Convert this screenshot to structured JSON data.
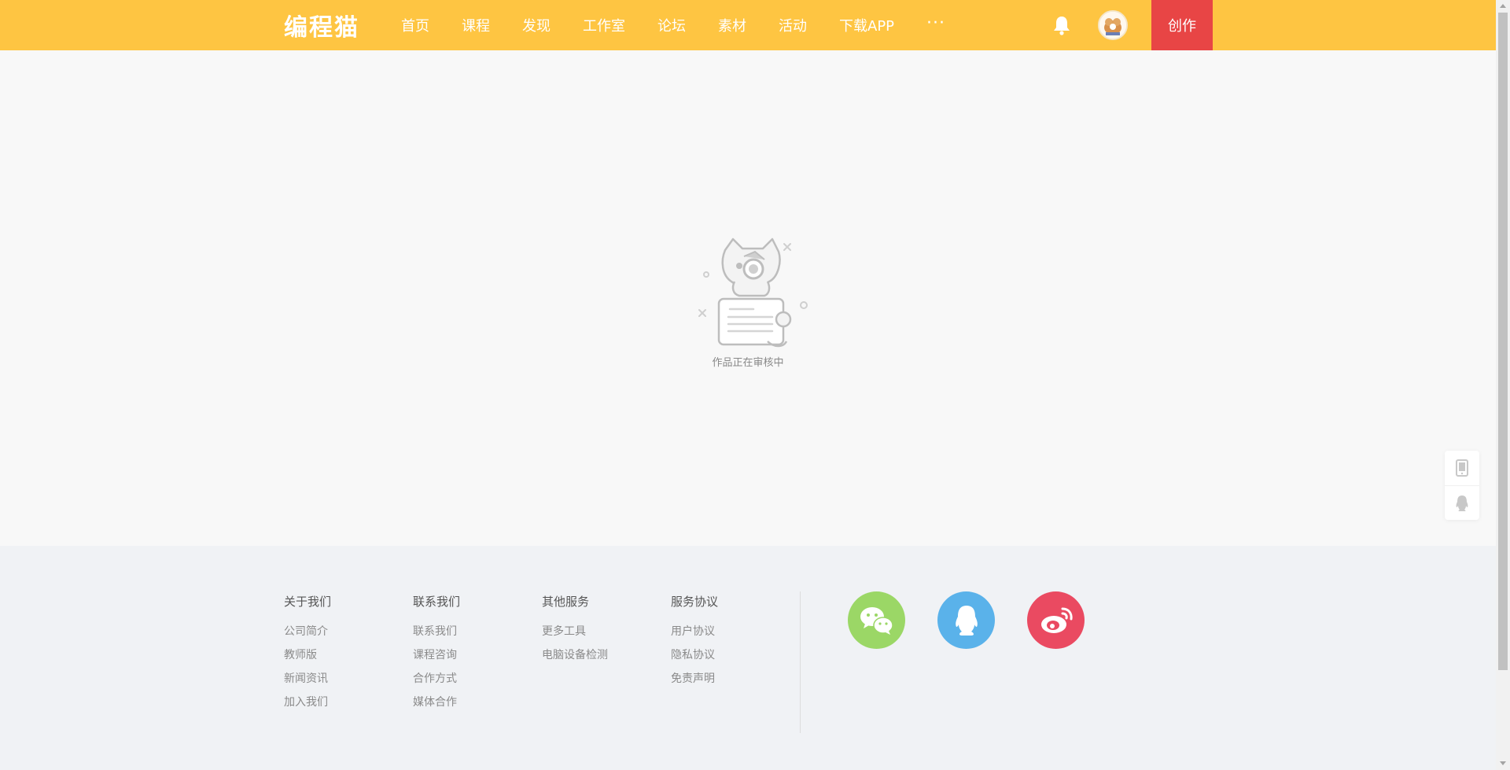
{
  "header": {
    "logo": "编程猫",
    "nav": [
      "首页",
      "课程",
      "发现",
      "工作室",
      "论坛",
      "素材",
      "活动",
      "下载APP"
    ],
    "more": "···",
    "create_label": "创作",
    "bell_icon": "bell-icon",
    "accent_color": "#fec542",
    "create_color": "#e84545"
  },
  "main": {
    "status_text": "作品正在审核中"
  },
  "side": {
    "items": [
      "mobile-icon",
      "qq-icon"
    ]
  },
  "footer": {
    "columns": [
      {
        "title": "关于我们",
        "links": [
          "公司简介",
          "教师版",
          "新闻资讯",
          "加入我们"
        ]
      },
      {
        "title": "联系我们",
        "links": [
          "联系我们",
          "课程咨询",
          "合作方式",
          "媒体合作"
        ]
      },
      {
        "title": "其他服务",
        "links": [
          "更多工具",
          "电脑设备检测"
        ]
      },
      {
        "title": "服务协议",
        "links": [
          "用户协议",
          "隐私协议",
          "免责声明"
        ]
      }
    ],
    "social": [
      {
        "icon": "wechat-icon",
        "color": "#9bd766"
      },
      {
        "icon": "qq-icon",
        "color": "#5ab2ea"
      },
      {
        "icon": "weibo-icon",
        "color": "#ea4a61"
      }
    ]
  }
}
